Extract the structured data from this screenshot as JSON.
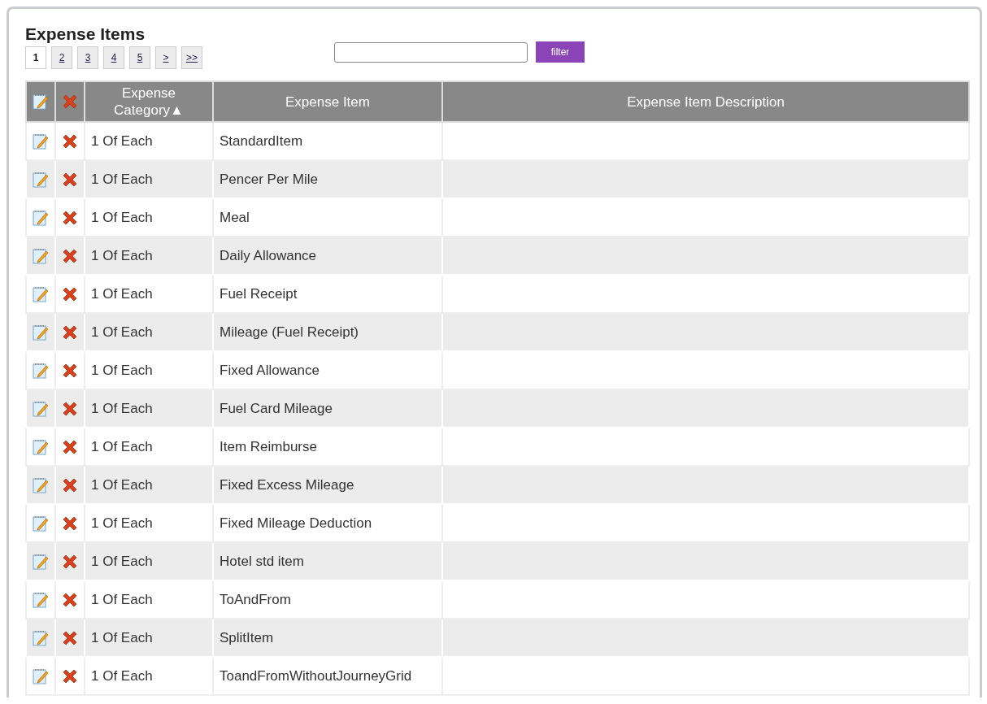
{
  "title": "Expense Items",
  "pager": [
    {
      "label": "1",
      "selected": true
    },
    {
      "label": "2",
      "selected": false
    },
    {
      "label": "3",
      "selected": false
    },
    {
      "label": "4",
      "selected": false
    },
    {
      "label": "5",
      "selected": false
    },
    {
      "label": ">",
      "selected": false
    },
    {
      "label": ">>",
      "selected": false
    }
  ],
  "filter": {
    "button": "filter"
  },
  "table": {
    "columns": [
      {
        "kind": "edit"
      },
      {
        "kind": "delete"
      },
      {
        "kind": "text",
        "label": "Expense Category",
        "sort": "▲"
      },
      {
        "kind": "text",
        "label": "Expense Item"
      },
      {
        "kind": "text",
        "label": "Expense Item Description"
      }
    ],
    "rows": [
      {
        "category": "1 Of Each",
        "item": "StandardItem"
      },
      {
        "category": "1 Of Each",
        "item": "Pencer Per Mile"
      },
      {
        "category": "1 Of Each",
        "item": "Meal"
      },
      {
        "category": "1 Of Each",
        "item": "Daily Allowance"
      },
      {
        "category": "1 Of Each",
        "item": "Fuel Receipt"
      },
      {
        "category": "1 Of Each",
        "item": "Mileage (Fuel Receipt)"
      },
      {
        "category": "1 Of Each",
        "item": "Fixed Allowance"
      },
      {
        "category": "1 Of Each",
        "item": "Fuel Card Mileage"
      },
      {
        "category": "1 Of Each",
        "item": "Item Reimburse"
      },
      {
        "category": "1 Of Each",
        "item": "Fixed Excess Mileage"
      },
      {
        "category": "1 Of Each",
        "item": "Fixed Mileage Deduction"
      },
      {
        "category": "1 Of Each",
        "item": "Hotel std item"
      },
      {
        "category": "1 Of Each",
        "item": "ToAndFrom"
      },
      {
        "category": "1 Of Each",
        "item": "SplitItem"
      },
      {
        "category": "1 Of Each",
        "item": "ToandFromWithoutJourneyGrid"
      }
    ]
  }
}
